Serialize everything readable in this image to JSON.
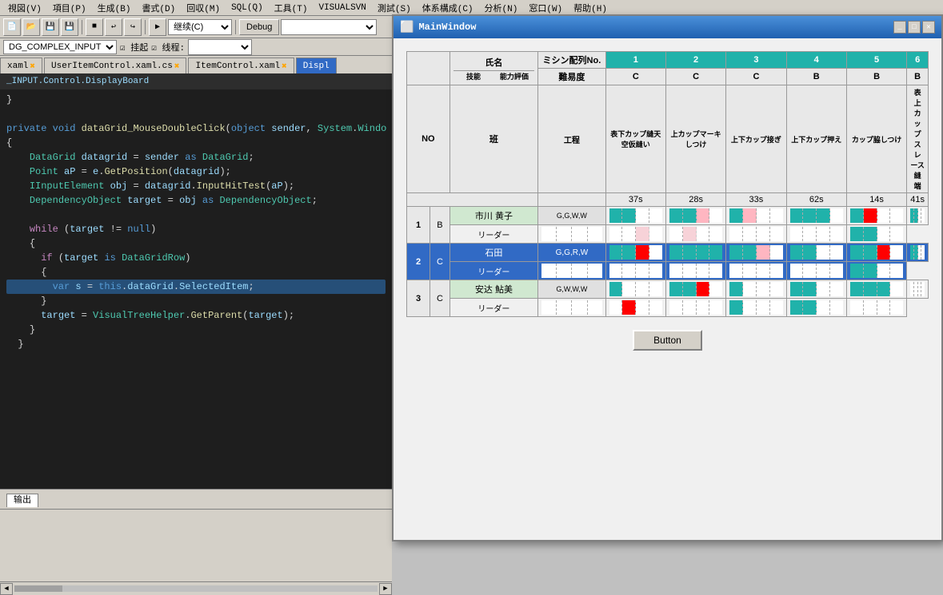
{
  "menubar": {
    "items": [
      "視図(V)",
      "項目(P)",
      "生成(B)",
      "書式(D)",
      "回収(M)",
      "SQL(Q)",
      "工具(T)",
      "VISUALSVN",
      "測試(S)",
      "体系構成(C)",
      "分析(N)",
      "窓口(W)",
      "帮助(H)"
    ]
  },
  "toolbar": {
    "continue_label": "继续(C)",
    "debug_label": "Debug"
  },
  "project": {
    "combo_value": "DG_COMPLEX_INPUT",
    "attach_label": "挂起",
    "thread_label": "线程:"
  },
  "tabs": [
    {
      "label": "xaml",
      "modified": true
    },
    {
      "label": "UserItemControl.xaml.cs",
      "modified": true
    },
    {
      "label": "ItemControl.xaml",
      "modified": true
    },
    {
      "label": "Displ",
      "active": true
    }
  ],
  "breadcrumb": "_INPUT.Control.DisplayBoard",
  "code": {
    "lines": [
      {
        "ln": "",
        "text": "  }"
      },
      {
        "ln": "",
        "text": ""
      },
      {
        "ln": "",
        "text": "  private void dataGrid_MouseDoubleClick(object sender, System.Windo"
      },
      {
        "ln": "",
        "text": "  {"
      },
      {
        "ln": "",
        "text": "    DataGrid datagrid = sender as DataGrid;"
      },
      {
        "ln": "",
        "text": "    Point aP = e.GetPosition(datagrid);"
      },
      {
        "ln": "",
        "text": "    IInputElement obj = datagrid.InputHitTest(aP);"
      },
      {
        "ln": "",
        "text": "    DependencyObject target = obj as DependencyObject;"
      },
      {
        "ln": "",
        "text": ""
      },
      {
        "ln": "",
        "text": "    while (target != null)"
      },
      {
        "ln": "",
        "text": "    {"
      },
      {
        "ln": "",
        "text": "      if (target is DataGridRow)"
      },
      {
        "ln": "",
        "text": "      {"
      },
      {
        "ln": "",
        "highlighted": true,
        "text": "        var s = this.dataGrid.SelectedItem;"
      },
      {
        "ln": "",
        "text": "      }"
      },
      {
        "ln": "",
        "text": "      target = VisualTreeHelper.GetParent(target);"
      },
      {
        "ln": "",
        "text": "    }"
      },
      {
        "ln": "",
        "text": "  }"
      }
    ]
  },
  "mainwindow": {
    "title": "MainWindow",
    "grid": {
      "header_row1": {
        "label_no": "NO",
        "label_ban": "班",
        "label_name": "氏名",
        "label_skill": "技能",
        "label_ability": "能力評価",
        "col1_label": "ミシン配列No.",
        "col2_label": "難易度",
        "col3_label": "工程",
        "col_nums": [
          "1",
          "2",
          "3",
          "4",
          "5",
          "6"
        ]
      },
      "difficulty": [
        "C",
        "C",
        "C",
        "B",
        "B",
        "B"
      ],
      "processes": [
        "表下カップ縫天空仮縫い",
        "上カップマーキしつけ",
        "上下カップ接ぎ",
        "上下カップ押え",
        "カップ脇しつけ",
        "表上カップスレース縫端"
      ],
      "times": [
        "37s",
        "28s",
        "33s",
        "62s",
        "14s",
        "41s"
      ],
      "rows": [
        {
          "no": "1",
          "ban": "B",
          "person": "市川 黄子",
          "leader": "リーダー",
          "skills": [
            "G,G,W,W",
            "G,G,P,W",
            "G,P,W,W",
            "G,G,G,W",
            "G,R,W,W",
            ""
          ],
          "skill_bars": [
            [
              "teal",
              "teal",
              "white",
              "white"
            ],
            [
              "teal",
              "teal",
              "pink",
              "white"
            ],
            [
              "teal",
              "pink",
              "white",
              "white"
            ],
            [
              "teal",
              "teal",
              "teal",
              "white"
            ],
            [
              "teal",
              "red",
              "white",
              "white"
            ],
            [
              "teal",
              "teal",
              "white",
              "white"
            ]
          ]
        },
        {
          "no": "2",
          "ban": "C",
          "person": "石田",
          "leader": "リーダー",
          "skills": [
            "G,G,R,W",
            "G,G,G,G",
            "G,G,P,W",
            "G,G,W,W",
            "G,G,R,W",
            ""
          ],
          "selected": true,
          "skill_bars": [
            [
              "teal",
              "teal",
              "red",
              "white"
            ],
            [
              "teal",
              "teal",
              "teal",
              "teal"
            ],
            [
              "teal",
              "teal",
              "pink",
              "white"
            ],
            [
              "teal",
              "teal",
              "white",
              "white"
            ],
            [
              "teal",
              "teal",
              "red",
              "white"
            ],
            [
              "teal",
              "teal",
              "white",
              "white"
            ]
          ]
        },
        {
          "no": "3",
          "ban": "C",
          "person": "安达 鮎美",
          "leader": "リーダー",
          "skills": [
            "G,W,W,W",
            "G,G,R,W",
            "G,W,W,W",
            "G,G,W,W",
            "G,G,G,W",
            ""
          ],
          "skill_bars": [
            [
              "teal",
              "white",
              "white",
              "white"
            ],
            [
              "teal",
              "teal",
              "red",
              "white"
            ],
            [
              "teal",
              "white",
              "white",
              "white"
            ],
            [
              "teal",
              "teal",
              "white",
              "white"
            ],
            [
              "teal",
              "teal",
              "teal",
              "white"
            ],
            [
              "teal",
              "white",
              "white",
              "white"
            ]
          ]
        }
      ]
    },
    "button_label": "Button"
  }
}
